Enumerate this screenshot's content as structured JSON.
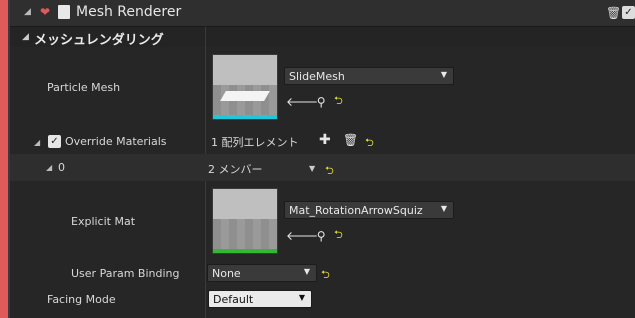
{
  "module": {
    "title": "Mesh Renderer",
    "expand_glyph": "◢",
    "emitter_icon": "heart-icon",
    "module_icon": "cube-icon",
    "delete_glyph": "🗑",
    "enabled_glyph": "✓"
  },
  "section": {
    "label": "メッシュレンダリング",
    "expand_glyph": "◢"
  },
  "particle_mesh": {
    "label": "Particle Mesh",
    "asset": "SlideMesh",
    "browse_glyph": "🡐",
    "find_glyph": "⚲",
    "reset_glyph": "⮌",
    "bar_color": "#1ec8d8"
  },
  "override_materials": {
    "label": "Override Materials",
    "checked_glyph": "✓",
    "expand_glyph": "◢",
    "count_text": "1 配列エレメント",
    "add_glyph": "✚",
    "delete_glyph": "🗑",
    "reset_glyph": "⮌"
  },
  "element_0": {
    "index": "0",
    "expand_glyph": "◢",
    "members_text": "2 メンバー",
    "members_caret": "▼",
    "reset_glyph": "⮌"
  },
  "explicit_mat": {
    "label": "Explicit Mat",
    "asset": "Mat_RotationArrowSquiz",
    "browse_glyph": "🡐",
    "find_glyph": "⚲",
    "reset_glyph": "⮌",
    "bar_color": "#33b833"
  },
  "user_param_binding": {
    "label": "User Param Binding",
    "value": "None",
    "reset_glyph": "⮌"
  },
  "facing_mode": {
    "label": "Facing Mode",
    "value": "Default"
  },
  "caret_glyph": "▼"
}
